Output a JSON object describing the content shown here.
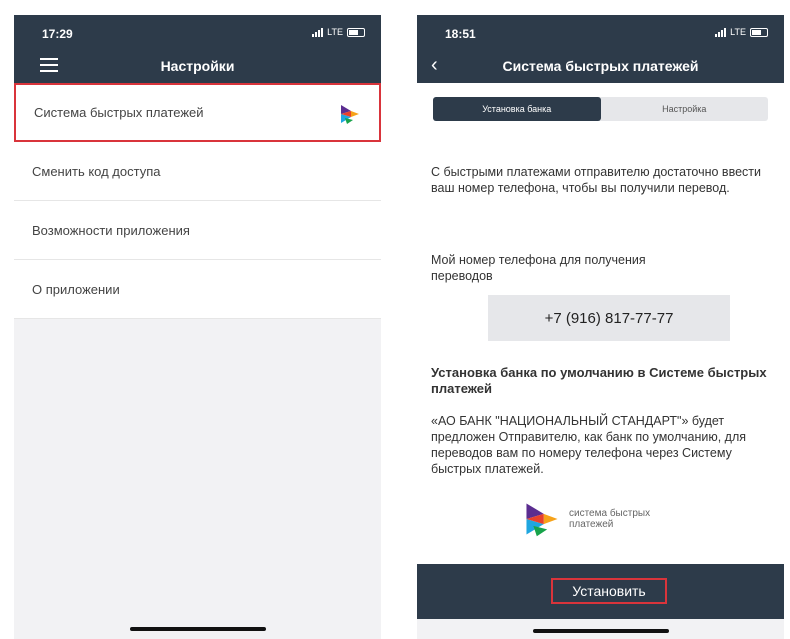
{
  "left_screen": {
    "status_time": "17:29",
    "status_net": "LTE",
    "nav_title": "Настройки",
    "menu_items": [
      "Система быстрых платежей",
      "Сменить код доступа",
      "Возможности приложения",
      "О приложении"
    ]
  },
  "right_screen": {
    "status_time": "18:51",
    "status_net": "LTE",
    "nav_title": "Система быстрых платежей",
    "tabs": [
      "Установка банка",
      "Настройка"
    ],
    "intro": "С быстрыми платежами отправителю достаточно ввести ваш номер телефона, чтобы вы получили перевод.",
    "phone_label": "Мой номер телефона для получения переводов",
    "phone_number": "+7 (916) 817-77-77",
    "default_heading": "Установка банка по умолчанию в Системе быстрых платежей",
    "default_text": "«АО БАНК \"НАЦИОНАЛЬНЫЙ СТАНДАРТ\"» будет предложен Отправителю, как банк по умолчанию, для переводов вам по номеру телефона через Систему быстрых платежей.",
    "logo_line1": "система быстрых",
    "logo_line2": "платежей",
    "install_label": "Установить"
  },
  "colors": {
    "header_bg": "#2d3b4a",
    "highlight": "#d9343b",
    "list_bg": "#f2f2f4",
    "tab_inactive": "#e6e7ea"
  }
}
